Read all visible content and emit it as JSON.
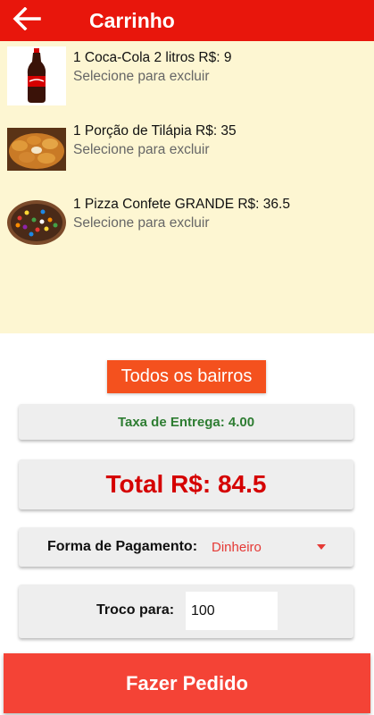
{
  "app_bar": {
    "title": "Carrinho",
    "back_icon": "arrow-left-icon",
    "color": "#e8160c"
  },
  "cart": {
    "background": "#fdf6d2",
    "items": [
      {
        "name": "1 Coca-Cola 2 litros  R$: 9",
        "hint": "Selecione para excluir",
        "image": "coca-cola-bottle"
      },
      {
        "name": "1 Porção de Tilápia  R$: 35",
        "hint": "Selecione para excluir",
        "image": "fried-fish-portion"
      },
      {
        "name": "1 Pizza Confete GRANDE  R$: 36.5",
        "hint": "Selecione para excluir",
        "image": "confetti-pizza"
      }
    ]
  },
  "neighborhood_button": {
    "label": "Todos os bairros",
    "color": "#f4511e"
  },
  "delivery_fee": {
    "text": "Taxa de Entrega:  4.00"
  },
  "total": {
    "text": "Total R$:  84.5"
  },
  "payment": {
    "label": "Forma de Pagamento:",
    "selected": "Dinheiro"
  },
  "change": {
    "label": "Troco para:",
    "value": "100"
  },
  "order_button": {
    "label": "Fazer Pedido",
    "color": "#f44336"
  }
}
